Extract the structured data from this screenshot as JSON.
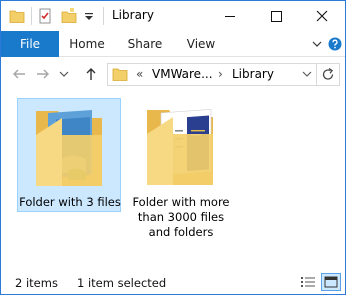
{
  "window": {
    "title": "Library",
    "controls": [
      "minimize",
      "maximize",
      "close"
    ]
  },
  "quick_access": {
    "icons": [
      "folder-icon",
      "properties-icon",
      "new-folder-icon",
      "customize-arrow-icon"
    ]
  },
  "ribbon": {
    "file": "File",
    "home": "Home",
    "share": "Share",
    "view": "View"
  },
  "address": {
    "overflow": "«",
    "segments": [
      "VMWare...",
      "Library"
    ],
    "separator": "›"
  },
  "items": [
    {
      "label": "Folder with 3 files",
      "selected": true
    },
    {
      "label_lines": [
        "Folder with more",
        "than 3000 files",
        "and folders"
      ],
      "selected": false
    }
  ],
  "status": {
    "count": "2 items",
    "selected": "1 item selected"
  },
  "colors": {
    "accent": "#1979ca",
    "selection_bg": "#cce8ff",
    "selection_border": "#99d1ff",
    "window_border": "#2b79d8",
    "folder": "#f3cf6a"
  }
}
